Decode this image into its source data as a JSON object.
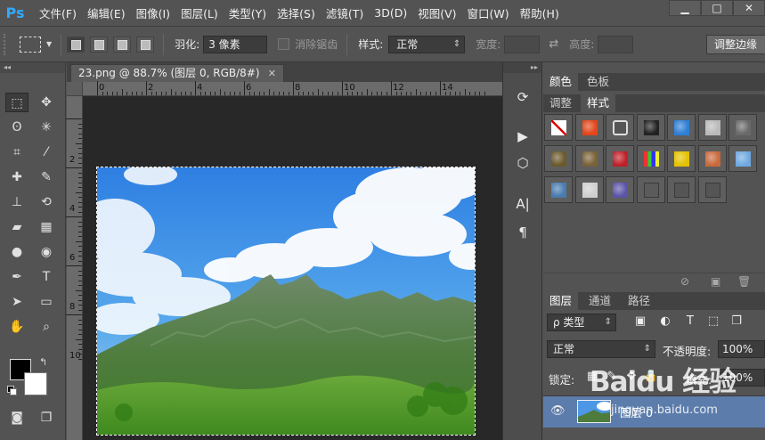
{
  "app": {
    "logo": "Ps",
    "accent": "#31a8ff"
  },
  "menu": [
    "文件(F)",
    "编辑(E)",
    "图像(I)",
    "图层(L)",
    "类型(Y)",
    "选择(S)",
    "滤镜(T)",
    "3D(D)",
    "视图(V)",
    "窗口(W)",
    "帮助(H)"
  ],
  "window_controls": {
    "minimize": "▁",
    "maximize": "□",
    "close": "✕"
  },
  "options": {
    "feather_label": "羽化:",
    "feather_value": "3 像素",
    "antialias_label": "消除锯齿",
    "style_label": "样式:",
    "style_value": "正常",
    "width_label": "宽度:",
    "height_label": "高度:",
    "refine_button": "调整边缘"
  },
  "document": {
    "tab_title": "23.png @ 88.7% (图层 0, RGB/8#)",
    "close": "✕",
    "ruler_top": [
      "0",
      "2",
      "4",
      "6",
      "8",
      "10",
      "12",
      "14"
    ],
    "ruler_left": [
      "2",
      "4",
      "6",
      "8",
      "10"
    ]
  },
  "toolbar": {
    "collapse": "◂◂",
    "tools": [
      {
        "name": "rect-marquee-icon",
        "glyph": "⬚"
      },
      {
        "name": "move-icon",
        "glyph": "✥"
      },
      {
        "name": "lasso-icon",
        "glyph": "ʘ"
      },
      {
        "name": "magic-wand-icon",
        "glyph": "✳"
      },
      {
        "name": "crop-icon",
        "glyph": "⌗"
      },
      {
        "name": "eyedropper-icon",
        "glyph": "⁄"
      },
      {
        "name": "healing-brush-icon",
        "glyph": "✚"
      },
      {
        "name": "brush-icon",
        "glyph": "✎"
      },
      {
        "name": "clone-stamp-icon",
        "glyph": "⊥"
      },
      {
        "name": "history-brush-icon",
        "glyph": "⟲"
      },
      {
        "name": "eraser-icon",
        "glyph": "▰"
      },
      {
        "name": "gradient-icon",
        "glyph": "▦"
      },
      {
        "name": "blur-icon",
        "glyph": "●"
      },
      {
        "name": "dodge-icon",
        "glyph": "◉"
      },
      {
        "name": "pen-icon",
        "glyph": "✒"
      },
      {
        "name": "type-icon",
        "glyph": "T"
      },
      {
        "name": "path-select-icon",
        "glyph": "➤"
      },
      {
        "name": "shape-icon",
        "glyph": "▭"
      },
      {
        "name": "hand-icon",
        "glyph": "✋"
      },
      {
        "name": "zoom-icon",
        "glyph": "⌕"
      },
      {
        "name": "quick-mask-icon",
        "glyph": "◙"
      },
      {
        "name": "screen-mode-icon",
        "glyph": "❐"
      }
    ],
    "swap_glyph": "↰",
    "foreground": "#000000",
    "background": "#ffffff"
  },
  "dock": {
    "collapse": "▸▸",
    "icons": [
      {
        "name": "history-panel-icon",
        "glyph": "⟳"
      },
      {
        "name": "actions-panel-icon",
        "glyph": "▶"
      },
      {
        "name": "3d-panel-icon",
        "glyph": "⬡"
      },
      {
        "name": "character-panel-icon",
        "glyph": "A|"
      },
      {
        "name": "paragraph-panel-icon",
        "glyph": "¶"
      }
    ]
  },
  "panels": {
    "top_tabs": [
      "颜色",
      "色板"
    ],
    "mid_tabs": [
      "调整",
      "样式"
    ],
    "styles": [
      {
        "bg": "#ffffff",
        "kind": "none"
      },
      {
        "bg": "#e2461a",
        "kind": "fill"
      },
      {
        "bg": "#555555",
        "kind": "selected"
      },
      {
        "bg": "#222222",
        "kind": "fill"
      },
      {
        "bg": "#2f7fd6",
        "kind": "fill"
      },
      {
        "bg": "#b9b9b9",
        "kind": "fill"
      },
      {
        "bg": "#6a6a6a",
        "kind": "fill"
      },
      {
        "bg": "#6c5a2e",
        "kind": "fill"
      },
      {
        "bg": "#7a6238",
        "kind": "fill"
      },
      {
        "bg": "#c0202a",
        "kind": "fill"
      },
      {
        "bg": "#333333",
        "kind": "multi"
      },
      {
        "bg": "#e3c200",
        "kind": "fill"
      },
      {
        "bg": "#c96a3c",
        "kind": "fill"
      },
      {
        "bg": "#6fa9e0",
        "kind": "fill"
      },
      {
        "bg": "#4a7bb0",
        "kind": "fill"
      },
      {
        "bg": "#cfcfcf",
        "kind": "fill"
      },
      {
        "bg": "#5b55a8",
        "kind": "fill"
      },
      {
        "bg": "#5b5b5b",
        "kind": "empty"
      },
      {
        "bg": "#555555",
        "kind": "empty"
      },
      {
        "bg": "#555555",
        "kind": "empty"
      }
    ],
    "footer_icons": [
      "⊘",
      "▣",
      "🗑"
    ],
    "layer_tabs": [
      "图层",
      "通道",
      "路径"
    ],
    "filter_kind": "ρ 类型",
    "blend_mode": "正常",
    "opacity_label": "不透明度:",
    "opacity_value": "100%",
    "lock_label": "锁定:",
    "fill_label": "填充:",
    "fill_value": "100%",
    "layer_name": "图层 0",
    "layer_highlight": "#5c7dab"
  },
  "watermark": {
    "brand": "Baidu 经验",
    "url": "jingyan.baidu.com"
  }
}
